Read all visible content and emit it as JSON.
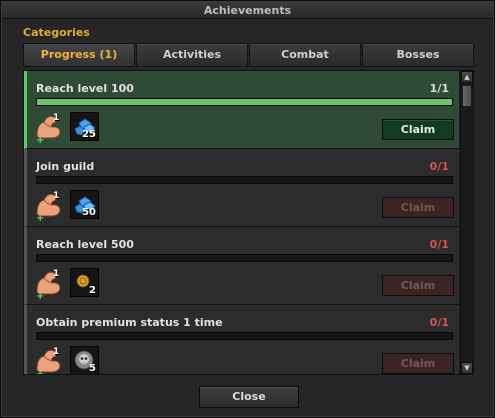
{
  "window": {
    "title": "Achievements"
  },
  "categories_label": "Categories",
  "tabs": [
    {
      "label": "Progress (1)",
      "active": true
    },
    {
      "label": "Activities",
      "active": false
    },
    {
      "label": "Combat",
      "active": false
    },
    {
      "label": "Bosses",
      "active": false
    }
  ],
  "achievements": [
    {
      "title": "Reach level 100",
      "count": "1/1",
      "progress": 1.0,
      "reward_qty": "1",
      "resource_icon": "blue-gem-icon",
      "resource_qty": "25",
      "claim_label": "Claim",
      "claimable": true
    },
    {
      "title": "Join guild",
      "count": "0/1",
      "progress": 0.0,
      "reward_qty": "1",
      "resource_icon": "blue-gem-icon",
      "resource_qty": "50",
      "claim_label": "Claim",
      "claimable": false
    },
    {
      "title": "Reach level 500",
      "count": "0/1",
      "progress": 0.0,
      "reward_qty": "1",
      "resource_icon": "gold-coin-icon",
      "resource_qty": "2",
      "claim_label": "Claim",
      "claimable": false
    },
    {
      "title": "Obtain premium status 1 time",
      "count": "0/1",
      "progress": 0.0,
      "reward_qty": "1",
      "resource_icon": "skull-orb-icon",
      "resource_qty": "5",
      "claim_label": "Claim",
      "claimable": false
    }
  ],
  "close_label": "Close",
  "colors": {
    "accent": "#f0b238",
    "completed_bg": "#2f4a36",
    "progress_fill": "#6ec26e",
    "count_incomplete": "#d9534f",
    "claim_enabled": "#123c22",
    "claim_disabled": "#3a2424"
  }
}
